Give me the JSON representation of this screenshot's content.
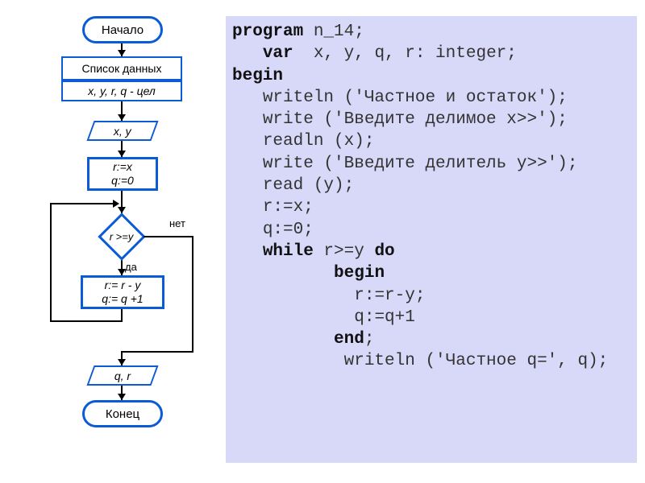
{
  "flowchart": {
    "start": "Начало",
    "data_list": "Список данных",
    "vars": "x, y, r, q - цел",
    "input": "x, y",
    "init": "r:=x\nq:=0",
    "cond": "r >=y",
    "yes": "да",
    "no": "нет",
    "body": "r:= r - y\nq:= q +1",
    "output": "q,  r",
    "end": "Конец"
  },
  "code": {
    "l1a": "program",
    "l1b": " n_14;",
    "l2a": "   var",
    "l2b": "  x, y, q, r: integer;",
    "l3": "begin",
    "l4": "   writeln ('Частное и остаток');",
    "l5": "   write ('Введите делимое x>>');",
    "l6": "   readln (x);",
    "l7": "   write ('Введите делитель y>>');",
    "l8": "   read (y);",
    "l9": "   r:=x;",
    "l10": "   q:=0;",
    "l11a": "   while",
    "l11b": " r>=y ",
    "l11c": "do",
    "l12": "          begin",
    "l13": "            r:=r-y;",
    "l14": "            q:=q+1",
    "l15a": "          end",
    "l15b": ";",
    "l16": "           writeln ('Частное q=', q);"
  },
  "chart_data": {
    "type": "flowchart",
    "nodes": [
      {
        "id": "start",
        "kind": "terminator",
        "label": "Начало"
      },
      {
        "id": "decl",
        "kind": "process",
        "label": "Список данных"
      },
      {
        "id": "vars",
        "kind": "process",
        "label": "x, y, r, q - цел"
      },
      {
        "id": "input",
        "kind": "io",
        "label": "x, y"
      },
      {
        "id": "init",
        "kind": "process",
        "label": "r:=x; q:=0"
      },
      {
        "id": "cond",
        "kind": "decision",
        "label": "r >= y"
      },
      {
        "id": "body",
        "kind": "process",
        "label": "r:=r-y; q:=q+1"
      },
      {
        "id": "output",
        "kind": "io",
        "label": "q, r"
      },
      {
        "id": "end",
        "kind": "terminator",
        "label": "Конец"
      }
    ],
    "edges": [
      {
        "from": "start",
        "to": "decl"
      },
      {
        "from": "decl",
        "to": "vars"
      },
      {
        "from": "vars",
        "to": "input"
      },
      {
        "from": "input",
        "to": "init"
      },
      {
        "from": "init",
        "to": "cond"
      },
      {
        "from": "cond",
        "to": "body",
        "label": "да"
      },
      {
        "from": "body",
        "to": "cond",
        "label": "loop-back"
      },
      {
        "from": "cond",
        "to": "output",
        "label": "нет"
      },
      {
        "from": "output",
        "to": "end"
      }
    ]
  }
}
